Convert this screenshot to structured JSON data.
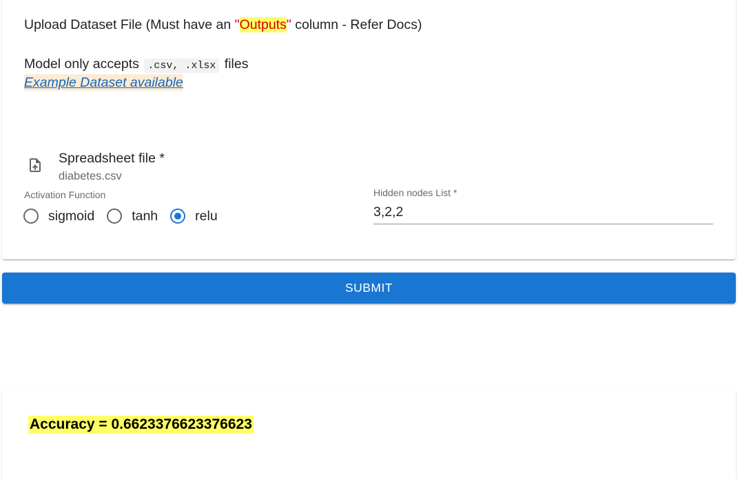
{
  "upload": {
    "title_prefix": "Upload Dataset File (Must have an ",
    "quote_open": "\"",
    "highlight": "Outputs",
    "quote_close": "\"",
    "title_suffix": " column - Refer Docs)",
    "accepts_prefix": "Model only accepts ",
    "accepts_code": ".csv, .xlsx",
    "accepts_suffix": " files",
    "example_link": "Example Dataset available"
  },
  "file": {
    "label": "Spreadsheet file *",
    "value": "diabetes.csv",
    "icon": "file-upload-icon"
  },
  "activation": {
    "label": "Activation Function",
    "options": [
      "sigmoid",
      "tanh",
      "relu"
    ],
    "selected": "relu"
  },
  "hidden_nodes": {
    "label": "Hidden nodes List *",
    "value": "3,2,2"
  },
  "submit": {
    "label": "SUBMIT"
  },
  "result": {
    "accuracy_text": "Accuracy = 0.6623376623376623"
  },
  "colors": {
    "primary": "#1976d2",
    "highlight": "#ffff66",
    "accent_red": "#d40000",
    "link": "#1565c0"
  }
}
